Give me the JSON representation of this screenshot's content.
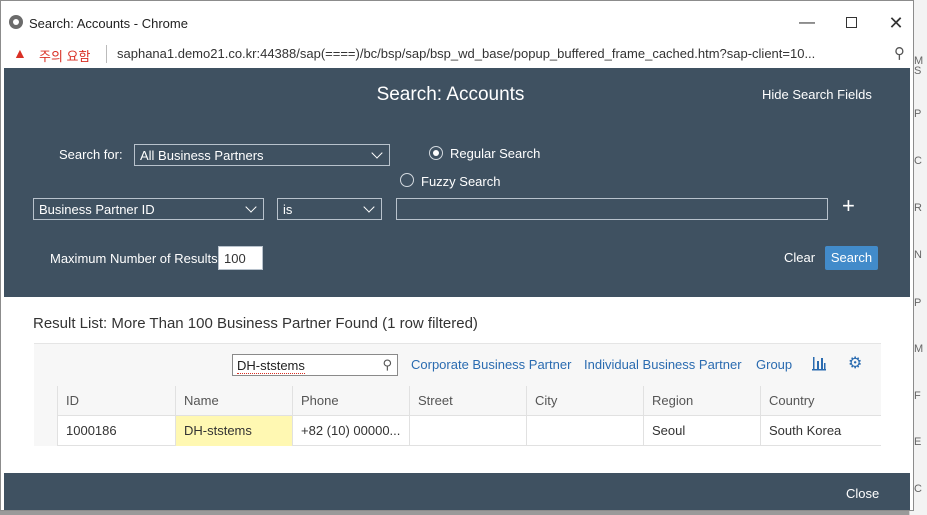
{
  "window": {
    "title": "Search: Accounts - Chrome",
    "warning_text": "주의 요함",
    "url": "saphana1.demo21.co.kr:44388/sap(====)/bc/bsp/sap/bsp_wd_base/popup_buffered_frame_cached.htm?sap-client=10..."
  },
  "background_page": {
    "letters": [
      "M",
      "S",
      "P",
      "C",
      "R",
      "N",
      "P",
      "M",
      "F",
      "E",
      "C"
    ]
  },
  "dialog": {
    "title": "Search: Accounts",
    "hide_fields_label": "Hide Search Fields",
    "search_for_label": "Search for:",
    "search_for_value": "All Business Partners",
    "regular_search_label": "Regular Search",
    "fuzzy_search_label": "Fuzzy Search",
    "criteria_field": "Business Partner ID",
    "criteria_operator": "is",
    "criteria_value": "",
    "plus_label": "+",
    "max_results_label": "Maximum Number of Results:",
    "max_results_value": "100",
    "clear_label": "Clear",
    "search_label": "Search",
    "close_label": "Close"
  },
  "results": {
    "title": "Result List: More Than 100 Business Partner Found (1 row filtered)",
    "filter_value": "DH-ststems",
    "toolbar": {
      "corporate": "Corporate Business Partner",
      "individual": "Individual Business Partner",
      "group": "Group"
    },
    "columns": [
      "ID",
      "Name",
      "Phone",
      "Street",
      "City",
      "Region",
      "Country"
    ],
    "rows": [
      {
        "id": "1000186",
        "name": "DH-ststems",
        "phone": "+82 (10) 00000...",
        "street": "",
        "city": "",
        "region": "Seoul",
        "country": "South Korea"
      }
    ]
  },
  "colors": {
    "header_bg": "#3f5161",
    "primary_button": "#428bca",
    "link": "#2a6bb0",
    "highlight": "#fff8b2"
  }
}
